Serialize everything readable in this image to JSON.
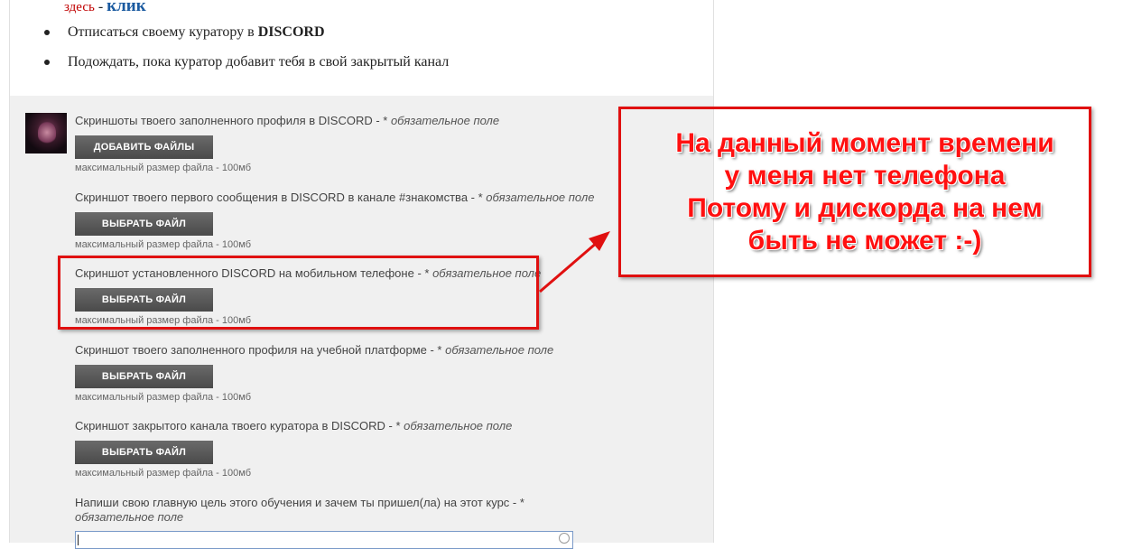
{
  "header": {
    "link_prefix": "здесь",
    "dash": " - ",
    "link_text": "клик"
  },
  "instructions": [
    {
      "text_before": "Отписаться своему куратору в ",
      "text_bold": "DISCORD"
    },
    {
      "text_before": "Подождать, пока куратор добавит тебя в свой закрытый канал",
      "text_bold": ""
    }
  ],
  "form": {
    "fields": [
      {
        "label": "Скриншоты твоего заполненного профиля в DISCORD - * ",
        "required": "обязательное поле",
        "button": "ДОБАВИТЬ ФАЙЛЫ",
        "hint": "максимальный размер файла - 100мб"
      },
      {
        "label": "Скриншот твоего первого сообщения в DISCORD в канале #знакомства - * ",
        "required": "обязательное поле",
        "button": "ВЫБРАТЬ ФАЙЛ",
        "hint": "максимальный размер файла - 100мб"
      },
      {
        "label": "Скриншот установленного DISCORD на мобильном телефоне - * ",
        "required": "обязательное поле",
        "button": "ВЫБРАТЬ ФАЙЛ",
        "hint": "максимальный размер файла - 100мб"
      },
      {
        "label": "Скриншот твоего заполненного профиля на учебной платформе - * ",
        "required": "обязательное поле",
        "button": "ВЫБРАТЬ ФАЙЛ",
        "hint": "максимальный размер файла - 100мб"
      },
      {
        "label": "Скриншот закрытого канала твоего куратора в DISCORD - * ",
        "required": "обязательное поле",
        "button": "ВЫБРАТЬ ФАЙЛ",
        "hint": "максимальный размер файла - 100мб"
      }
    ],
    "goal_field": {
      "label": "Напиши свою главную цель этого обучения и зачем ты пришел(ла) на этот курс - * ",
      "required": "обязательное поле",
      "value": ""
    }
  },
  "annotation": {
    "lines": [
      "На данный момент времени",
      "у меня нет телефона",
      "Потому и дискорда на нем",
      "быть не может :-)"
    ],
    "color": "#ff1010"
  }
}
